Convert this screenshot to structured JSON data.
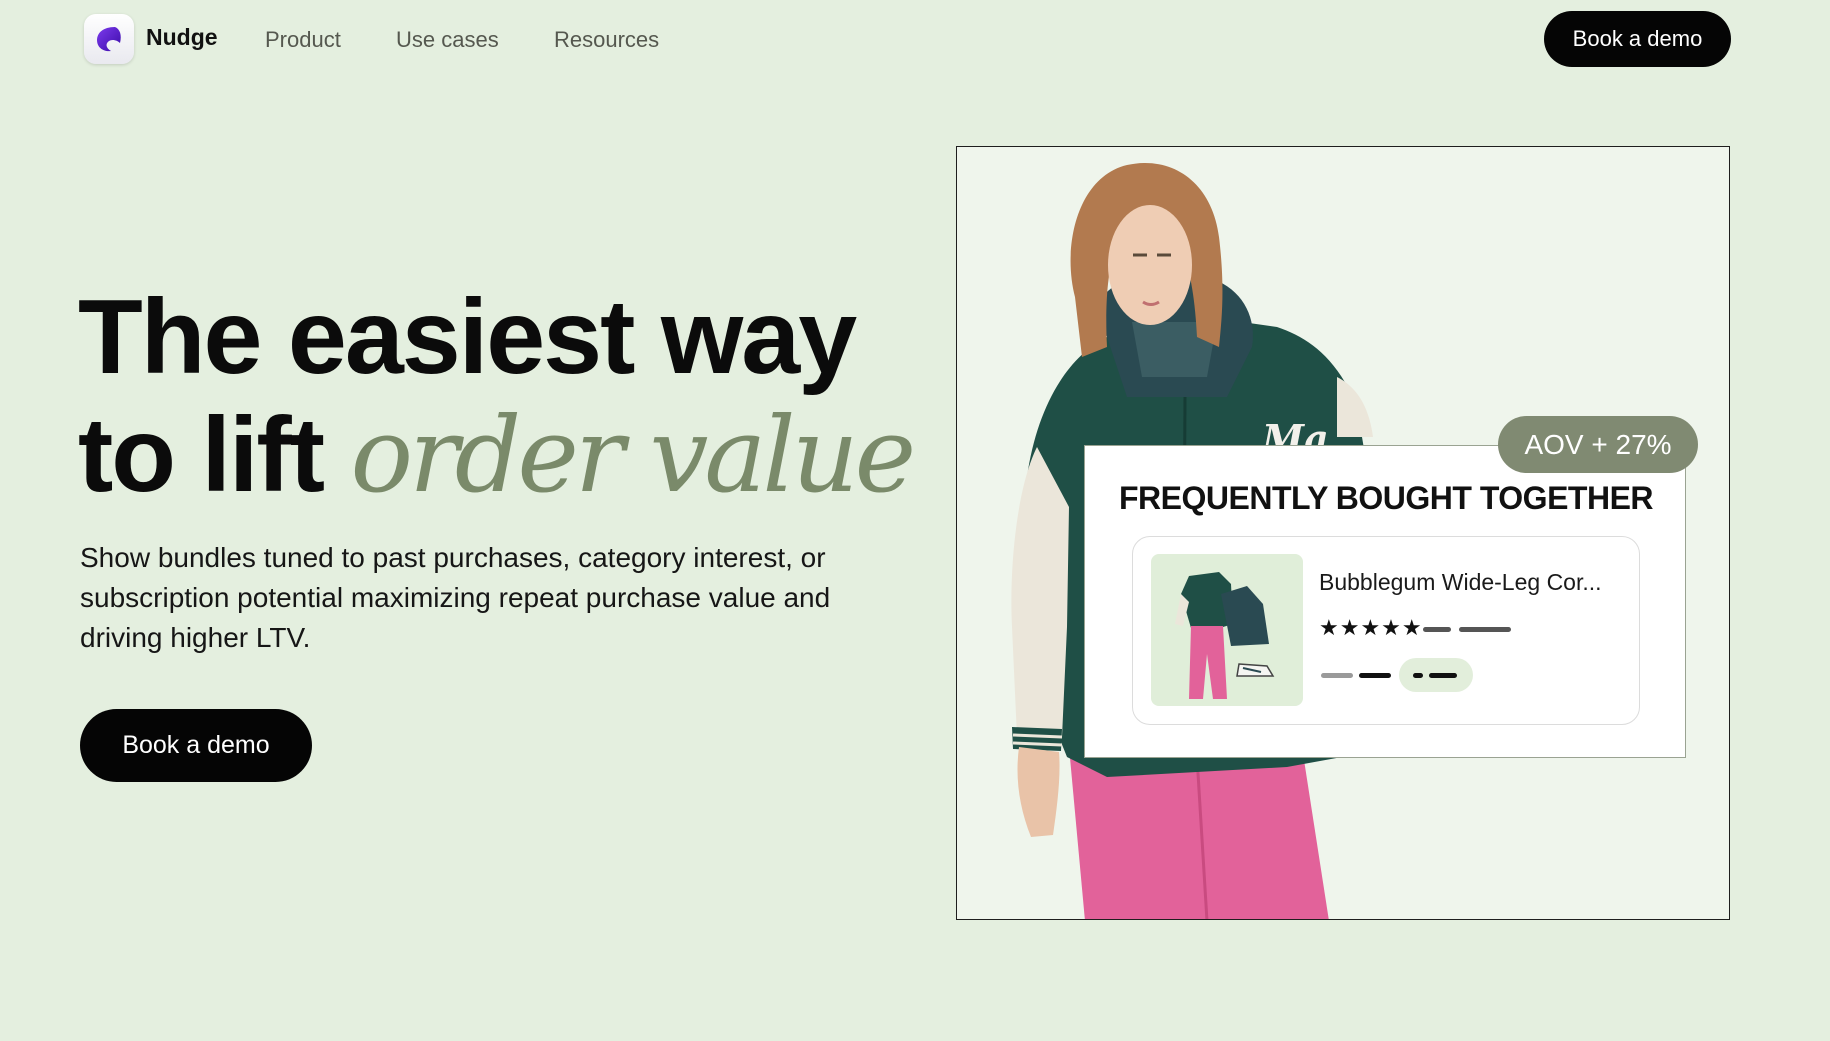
{
  "nav": {
    "brand": "Nudge",
    "links": [
      "Product",
      "Use cases",
      "Resources"
    ],
    "cta_label": "Book a demo"
  },
  "hero": {
    "headline_line1": "The easiest way",
    "headline_line2_plain": "to lift",
    "headline_line2_accent": "order value",
    "subtext": "Show bundles tuned to past purchases, category interest, or subscription potential maximizing repeat purchase value and driving higher LTV.",
    "cta_label": "Book a demo"
  },
  "widget": {
    "badge": "AOV + 27%",
    "title": "FREQUENTLY BOUGHT TOGETHER",
    "product_name": "Bubblegum Wide-Leg Cor...",
    "rating_stars": "★★★★★",
    "rating_value": 5
  },
  "colors": {
    "background": "#e4efdf",
    "accent_text": "#7a8a6a",
    "button": "#050505",
    "badge": "#808a72",
    "jacket": "#1f4f46",
    "pants": "#e25f97"
  },
  "icons": {
    "logo": "nudge-logo-icon",
    "star": "star-icon"
  }
}
